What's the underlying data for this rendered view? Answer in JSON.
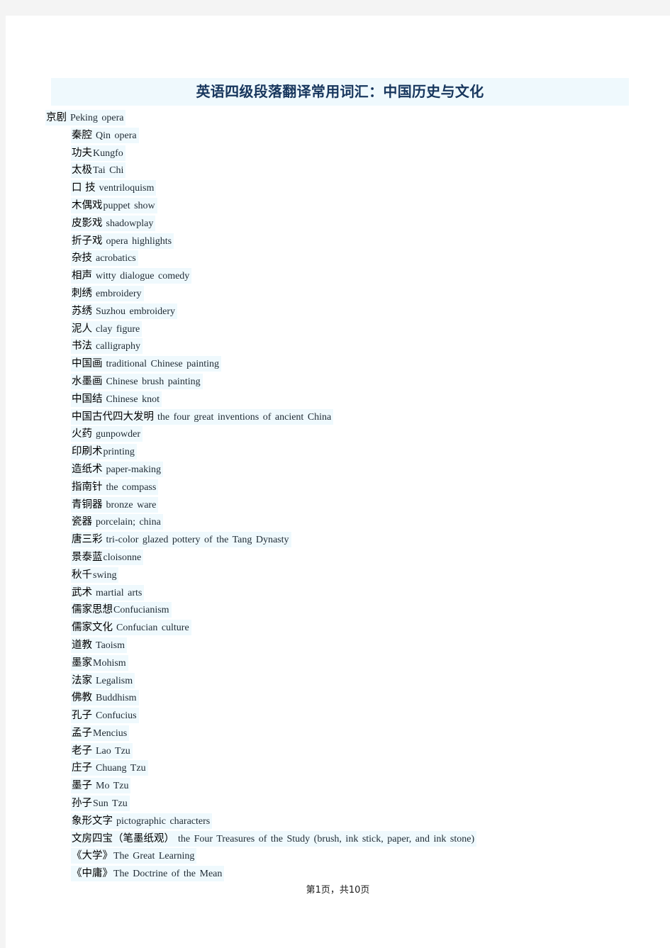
{
  "document": {
    "title": "英语四级段落翻译常用词汇：中国历史与文化",
    "footer": "第1页，共10页"
  },
  "colors": {
    "title_text": "#17365d",
    "highlight": "#eff9fd",
    "chinese_text": "#000000",
    "english_text": "#1f2a33",
    "page_background": "#ffffff",
    "viewer_background": "#f4f4f4"
  },
  "entries": [
    {
      "zh": "京剧",
      "en": "Peking opera",
      "first": true
    },
    {
      "zh": "秦腔",
      "en": "Qin opera"
    },
    {
      "zh": "功夫",
      "en": "Kungfo",
      "tight": true
    },
    {
      "zh": "太极",
      "en": "Tai Chi",
      "tight": true
    },
    {
      "zh": "口 技",
      "en": "ventriloquism"
    },
    {
      "zh": "木偶戏",
      "en": "puppet show",
      "tight": true
    },
    {
      "zh": "皮影戏",
      "en": "shadowplay"
    },
    {
      "zh": "折子戏",
      "en": "opera highlights"
    },
    {
      "zh": "杂技",
      "en": "acrobatics"
    },
    {
      "zh": "相声",
      "en": "witty dialogue comedy"
    },
    {
      "zh": "刺绣",
      "en": "embroidery"
    },
    {
      "zh": "苏绣",
      "en": "Suzhou embroidery"
    },
    {
      "zh": "泥人",
      "en": "clay figure"
    },
    {
      "zh": "书法",
      "en": "calligraphy"
    },
    {
      "zh": "中国画",
      "en": "traditional Chinese painting"
    },
    {
      "zh": "水墨画",
      "en": "Chinese brush painting"
    },
    {
      "zh": "中国结",
      "en": "Chinese knot"
    },
    {
      "zh": "中国古代四大发明",
      "en": "the four great inventions of ancient China"
    },
    {
      "zh": "火药",
      "en": "gunpowder"
    },
    {
      "zh": "印刷术",
      "en": "printing",
      "tight": true
    },
    {
      "zh": "造纸术",
      "en": "paper-making"
    },
    {
      "zh": "指南针",
      "en": "the compass"
    },
    {
      "zh": "青铜器",
      "en": "bronze ware"
    },
    {
      "zh": "瓷器",
      "en": "porcelain; china"
    },
    {
      "zh": "唐三彩",
      "en": "tri-color glazed pottery of the Tang Dynasty"
    },
    {
      "zh": "景泰蓝",
      "en": "cloisonne",
      "tight": true
    },
    {
      "zh": "秋千",
      "en": "swing",
      "tight": true
    },
    {
      "zh": "武术",
      "en": "martial arts"
    },
    {
      "zh": "儒家思想",
      "en": "Confucianism",
      "tight": true
    },
    {
      "zh": "儒家文化",
      "en": "Confucian culture"
    },
    {
      "zh": "道教",
      "en": "Taoism"
    },
    {
      "zh": "墨家",
      "en": "Mohism",
      "tight": true
    },
    {
      "zh": "法家",
      "en": "Legalism"
    },
    {
      "zh": "佛教",
      "en": "Buddhism"
    },
    {
      "zh": "孔子",
      "en": "Confucius"
    },
    {
      "zh": "孟子",
      "en": "Mencius",
      "tight": true
    },
    {
      "zh": "老子",
      "en": "Lao Tzu"
    },
    {
      "zh": "庄子",
      "en": "Chuang Tzu"
    },
    {
      "zh": "墨子",
      "en": "Mo Tzu"
    },
    {
      "zh": "孙子",
      "en": "Sun Tzu",
      "tight": true
    },
    {
      "zh": "象形文字",
      "en": "pictographic characters"
    },
    {
      "zh": "文房四宝（笔墨纸观）",
      "en": "the Four Treasures of the Study (brush, ink stick, paper, and ink stone)"
    },
    {
      "zh": "《大学》",
      "en": "The Great Learning",
      "tight": true
    },
    {
      "zh": "《中庸》",
      "en": "The Doctrine of the Mean",
      "tight": true
    }
  ]
}
